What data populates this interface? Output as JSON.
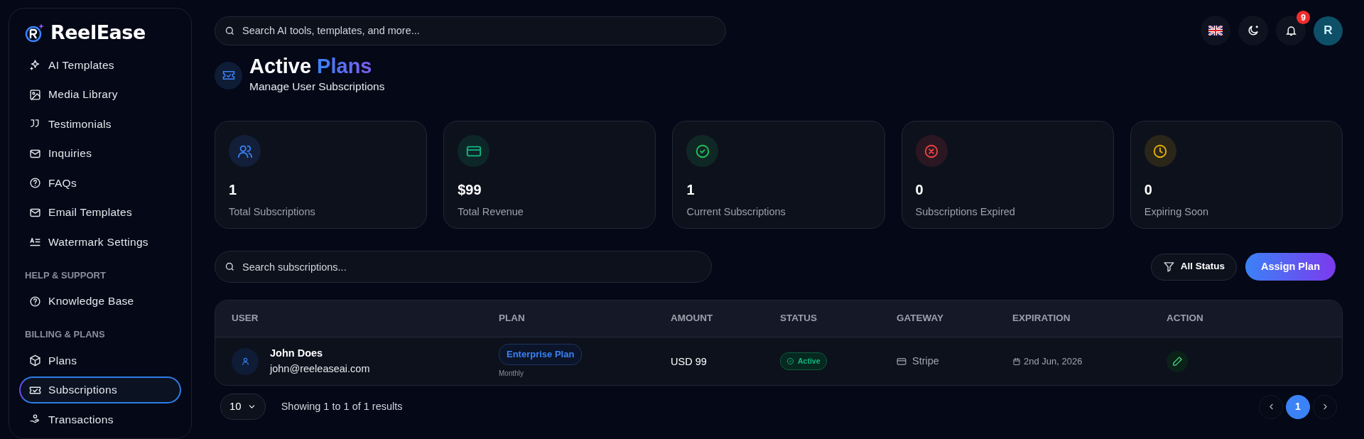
{
  "brand": {
    "name": "ReelEase"
  },
  "sidebar": {
    "sections": [
      {
        "items": [
          {
            "label": "AI Templates",
            "selected": false
          },
          {
            "label": "Media Library",
            "selected": false
          },
          {
            "label": "Testimonials",
            "selected": false
          },
          {
            "label": "Inquiries",
            "selected": false
          },
          {
            "label": "FAQs",
            "selected": false
          },
          {
            "label": "Email Templates",
            "selected": false
          },
          {
            "label": "Watermark Settings",
            "selected": false
          }
        ]
      },
      {
        "heading": "HELP & SUPPORT",
        "items": [
          {
            "label": "Knowledge Base",
            "selected": false
          }
        ]
      },
      {
        "heading": "BILLING & PLANS",
        "items": [
          {
            "label": "Plans",
            "selected": false
          },
          {
            "label": "Subscriptions",
            "selected": true
          },
          {
            "label": "Transactions",
            "selected": false
          }
        ]
      }
    ]
  },
  "topbar": {
    "search": {
      "placeholder": "Search AI tools, templates, and more..."
    },
    "notifications": {
      "count": "9"
    },
    "avatar": {
      "initial": "R"
    }
  },
  "header": {
    "title_1": "Active",
    "title_2": "Plans",
    "subtitle": "Manage User Subscriptions"
  },
  "stats": [
    {
      "value": "1",
      "label": "Total Subscriptions",
      "color": "#3b82f6"
    },
    {
      "value": "$99",
      "label": "Total Revenue",
      "color": "#10b981"
    },
    {
      "value": "1",
      "label": "Current Subscriptions",
      "color": "#22c55e"
    },
    {
      "value": "0",
      "label": "Subscriptions Expired",
      "color": "#ef4444"
    },
    {
      "value": "0",
      "label": "Expiring Soon",
      "color": "#eab308"
    }
  ],
  "toolbar": {
    "search": {
      "placeholder": "Search subscriptions..."
    },
    "filter": "All Status",
    "assign": "Assign Plan"
  },
  "table": {
    "columns": [
      "USER",
      "PLAN",
      "AMOUNT",
      "STATUS",
      "GATEWAY",
      "EXPIRATION",
      "ACTION"
    ],
    "rows": [
      {
        "name": "John Does",
        "email": "john@reeleaseai.com",
        "plan": "Enterprise Plan",
        "cycle": "Monthly",
        "amount": "USD 99",
        "status": {
          "kind": "active",
          "label": "Active"
        },
        "gateway": "Stripe",
        "expiration": "2nd Jun, 2026"
      }
    ]
  },
  "pagination": {
    "page_size": "10",
    "summary": "Showing 1 to 1 of 1 results",
    "pages": [
      {
        "label": "1",
        "selected": true
      }
    ]
  }
}
